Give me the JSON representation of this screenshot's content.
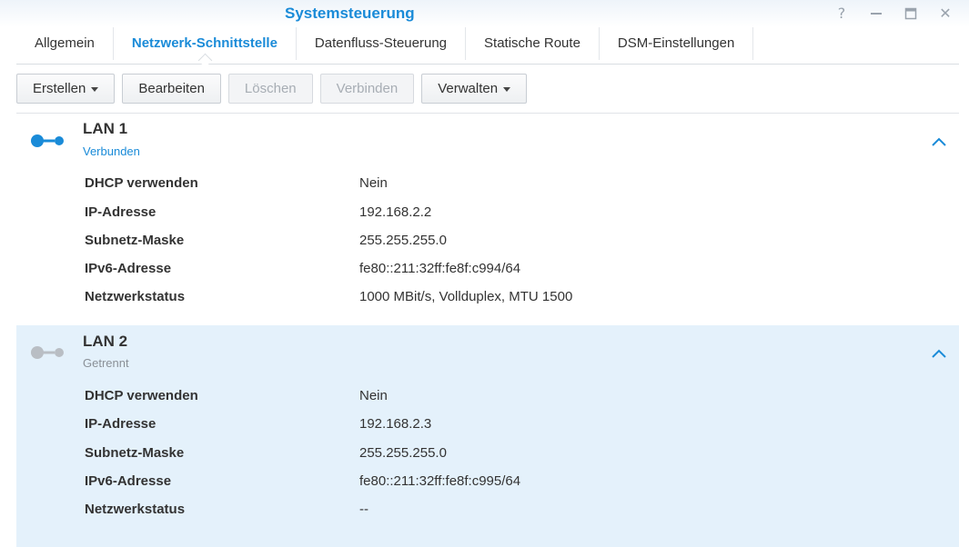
{
  "window": {
    "title": "Systemsteuerung",
    "controls": [
      "help-icon",
      "minimize-icon",
      "maximize-icon",
      "close-icon"
    ],
    "help_glyph": "?",
    "close_glyph": "✕"
  },
  "tabs": [
    {
      "label": "Allgemein",
      "active": false
    },
    {
      "label": "Netzwerk-Schnittstelle",
      "active": true
    },
    {
      "label": "Datenfluss-Steuerung",
      "active": false
    },
    {
      "label": "Statische Route",
      "active": false
    },
    {
      "label": "DSM-Einstellungen",
      "active": false
    }
  ],
  "toolbar": {
    "create_label": "Erstellen",
    "edit_label": "Bearbeiten",
    "delete_label": "Löschen",
    "connect_label": "Verbinden",
    "manage_label": "Verwalten"
  },
  "interfaces": [
    {
      "name": "LAN 1",
      "status": "Verbunden",
      "status_color": "#1a8bd8",
      "icon_color": "#1a8bd8",
      "expanded": true,
      "rows": [
        {
          "label": "DHCP verwenden",
          "value": "Nein"
        },
        {
          "label": "IP-Adresse",
          "value": "192.168.2.2"
        },
        {
          "label": "Subnetz-Maske",
          "value": "255.255.255.0"
        },
        {
          "label": "IPv6-Adresse",
          "value": "fe80::211:32ff:fe8f:c994/64"
        },
        {
          "label": "Netzwerkstatus",
          "value": "1000 MBit/s, Vollduplex, MTU 1500"
        }
      ]
    },
    {
      "name": "LAN 2",
      "status": "Getrennt",
      "status_color": "#8a9097",
      "icon_color": "#b9bec4",
      "expanded": true,
      "rows": [
        {
          "label": "DHCP verwenden",
          "value": "Nein"
        },
        {
          "label": "IP-Adresse",
          "value": "192.168.2.3"
        },
        {
          "label": "Subnetz-Maske",
          "value": "255.255.255.0"
        },
        {
          "label": "IPv6-Adresse",
          "value": "fe80::211:32ff:fe8f:c995/64"
        },
        {
          "label": "Netzwerkstatus",
          "value": "--"
        }
      ]
    }
  ],
  "colors": {
    "accent": "#1a8bd8",
    "selected_panel_bg": "#e4f1fb",
    "disabled_text": "#a7adb4"
  }
}
